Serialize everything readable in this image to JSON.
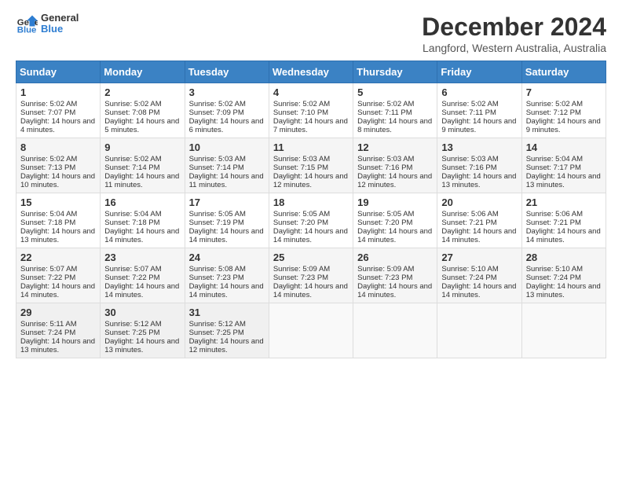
{
  "header": {
    "logo_line1": "General",
    "logo_line2": "Blue",
    "title": "December 2024",
    "subtitle": "Langford, Western Australia, Australia"
  },
  "weekdays": [
    "Sunday",
    "Monday",
    "Tuesday",
    "Wednesday",
    "Thursday",
    "Friday",
    "Saturday"
  ],
  "weeks": [
    [
      {
        "day": "1",
        "sunrise": "Sunrise: 5:02 AM",
        "sunset": "Sunset: 7:07 PM",
        "daylight": "Daylight: 14 hours and 4 minutes."
      },
      {
        "day": "2",
        "sunrise": "Sunrise: 5:02 AM",
        "sunset": "Sunset: 7:08 PM",
        "daylight": "Daylight: 14 hours and 5 minutes."
      },
      {
        "day": "3",
        "sunrise": "Sunrise: 5:02 AM",
        "sunset": "Sunset: 7:09 PM",
        "daylight": "Daylight: 14 hours and 6 minutes."
      },
      {
        "day": "4",
        "sunrise": "Sunrise: 5:02 AM",
        "sunset": "Sunset: 7:10 PM",
        "daylight": "Daylight: 14 hours and 7 minutes."
      },
      {
        "day": "5",
        "sunrise": "Sunrise: 5:02 AM",
        "sunset": "Sunset: 7:11 PM",
        "daylight": "Daylight: 14 hours and 8 minutes."
      },
      {
        "day": "6",
        "sunrise": "Sunrise: 5:02 AM",
        "sunset": "Sunset: 7:11 PM",
        "daylight": "Daylight: 14 hours and 9 minutes."
      },
      {
        "day": "7",
        "sunrise": "Sunrise: 5:02 AM",
        "sunset": "Sunset: 7:12 PM",
        "daylight": "Daylight: 14 hours and 9 minutes."
      }
    ],
    [
      {
        "day": "8",
        "sunrise": "Sunrise: 5:02 AM",
        "sunset": "Sunset: 7:13 PM",
        "daylight": "Daylight: 14 hours and 10 minutes."
      },
      {
        "day": "9",
        "sunrise": "Sunrise: 5:02 AM",
        "sunset": "Sunset: 7:14 PM",
        "daylight": "Daylight: 14 hours and 11 minutes."
      },
      {
        "day": "10",
        "sunrise": "Sunrise: 5:03 AM",
        "sunset": "Sunset: 7:14 PM",
        "daylight": "Daylight: 14 hours and 11 minutes."
      },
      {
        "day": "11",
        "sunrise": "Sunrise: 5:03 AM",
        "sunset": "Sunset: 7:15 PM",
        "daylight": "Daylight: 14 hours and 12 minutes."
      },
      {
        "day": "12",
        "sunrise": "Sunrise: 5:03 AM",
        "sunset": "Sunset: 7:16 PM",
        "daylight": "Daylight: 14 hours and 12 minutes."
      },
      {
        "day": "13",
        "sunrise": "Sunrise: 5:03 AM",
        "sunset": "Sunset: 7:16 PM",
        "daylight": "Daylight: 14 hours and 13 minutes."
      },
      {
        "day": "14",
        "sunrise": "Sunrise: 5:04 AM",
        "sunset": "Sunset: 7:17 PM",
        "daylight": "Daylight: 14 hours and 13 minutes."
      }
    ],
    [
      {
        "day": "15",
        "sunrise": "Sunrise: 5:04 AM",
        "sunset": "Sunset: 7:18 PM",
        "daylight": "Daylight: 14 hours and 13 minutes."
      },
      {
        "day": "16",
        "sunrise": "Sunrise: 5:04 AM",
        "sunset": "Sunset: 7:18 PM",
        "daylight": "Daylight: 14 hours and 14 minutes."
      },
      {
        "day": "17",
        "sunrise": "Sunrise: 5:05 AM",
        "sunset": "Sunset: 7:19 PM",
        "daylight": "Daylight: 14 hours and 14 minutes."
      },
      {
        "day": "18",
        "sunrise": "Sunrise: 5:05 AM",
        "sunset": "Sunset: 7:20 PM",
        "daylight": "Daylight: 14 hours and 14 minutes."
      },
      {
        "day": "19",
        "sunrise": "Sunrise: 5:05 AM",
        "sunset": "Sunset: 7:20 PM",
        "daylight": "Daylight: 14 hours and 14 minutes."
      },
      {
        "day": "20",
        "sunrise": "Sunrise: 5:06 AM",
        "sunset": "Sunset: 7:21 PM",
        "daylight": "Daylight: 14 hours and 14 minutes."
      },
      {
        "day": "21",
        "sunrise": "Sunrise: 5:06 AM",
        "sunset": "Sunset: 7:21 PM",
        "daylight": "Daylight: 14 hours and 14 minutes."
      }
    ],
    [
      {
        "day": "22",
        "sunrise": "Sunrise: 5:07 AM",
        "sunset": "Sunset: 7:22 PM",
        "daylight": "Daylight: 14 hours and 14 minutes."
      },
      {
        "day": "23",
        "sunrise": "Sunrise: 5:07 AM",
        "sunset": "Sunset: 7:22 PM",
        "daylight": "Daylight: 14 hours and 14 minutes."
      },
      {
        "day": "24",
        "sunrise": "Sunrise: 5:08 AM",
        "sunset": "Sunset: 7:23 PM",
        "daylight": "Daylight: 14 hours and 14 minutes."
      },
      {
        "day": "25",
        "sunrise": "Sunrise: 5:09 AM",
        "sunset": "Sunset: 7:23 PM",
        "daylight": "Daylight: 14 hours and 14 minutes."
      },
      {
        "day": "26",
        "sunrise": "Sunrise: 5:09 AM",
        "sunset": "Sunset: 7:23 PM",
        "daylight": "Daylight: 14 hours and 14 minutes."
      },
      {
        "day": "27",
        "sunrise": "Sunrise: 5:10 AM",
        "sunset": "Sunset: 7:24 PM",
        "daylight": "Daylight: 14 hours and 14 minutes."
      },
      {
        "day": "28",
        "sunrise": "Sunrise: 5:10 AM",
        "sunset": "Sunset: 7:24 PM",
        "daylight": "Daylight: 14 hours and 13 minutes."
      }
    ],
    [
      {
        "day": "29",
        "sunrise": "Sunrise: 5:11 AM",
        "sunset": "Sunset: 7:24 PM",
        "daylight": "Daylight: 14 hours and 13 minutes."
      },
      {
        "day": "30",
        "sunrise": "Sunrise: 5:12 AM",
        "sunset": "Sunset: 7:25 PM",
        "daylight": "Daylight: 14 hours and 13 minutes."
      },
      {
        "day": "31",
        "sunrise": "Sunrise: 5:12 AM",
        "sunset": "Sunset: 7:25 PM",
        "daylight": "Daylight: 14 hours and 12 minutes."
      },
      null,
      null,
      null,
      null
    ]
  ]
}
